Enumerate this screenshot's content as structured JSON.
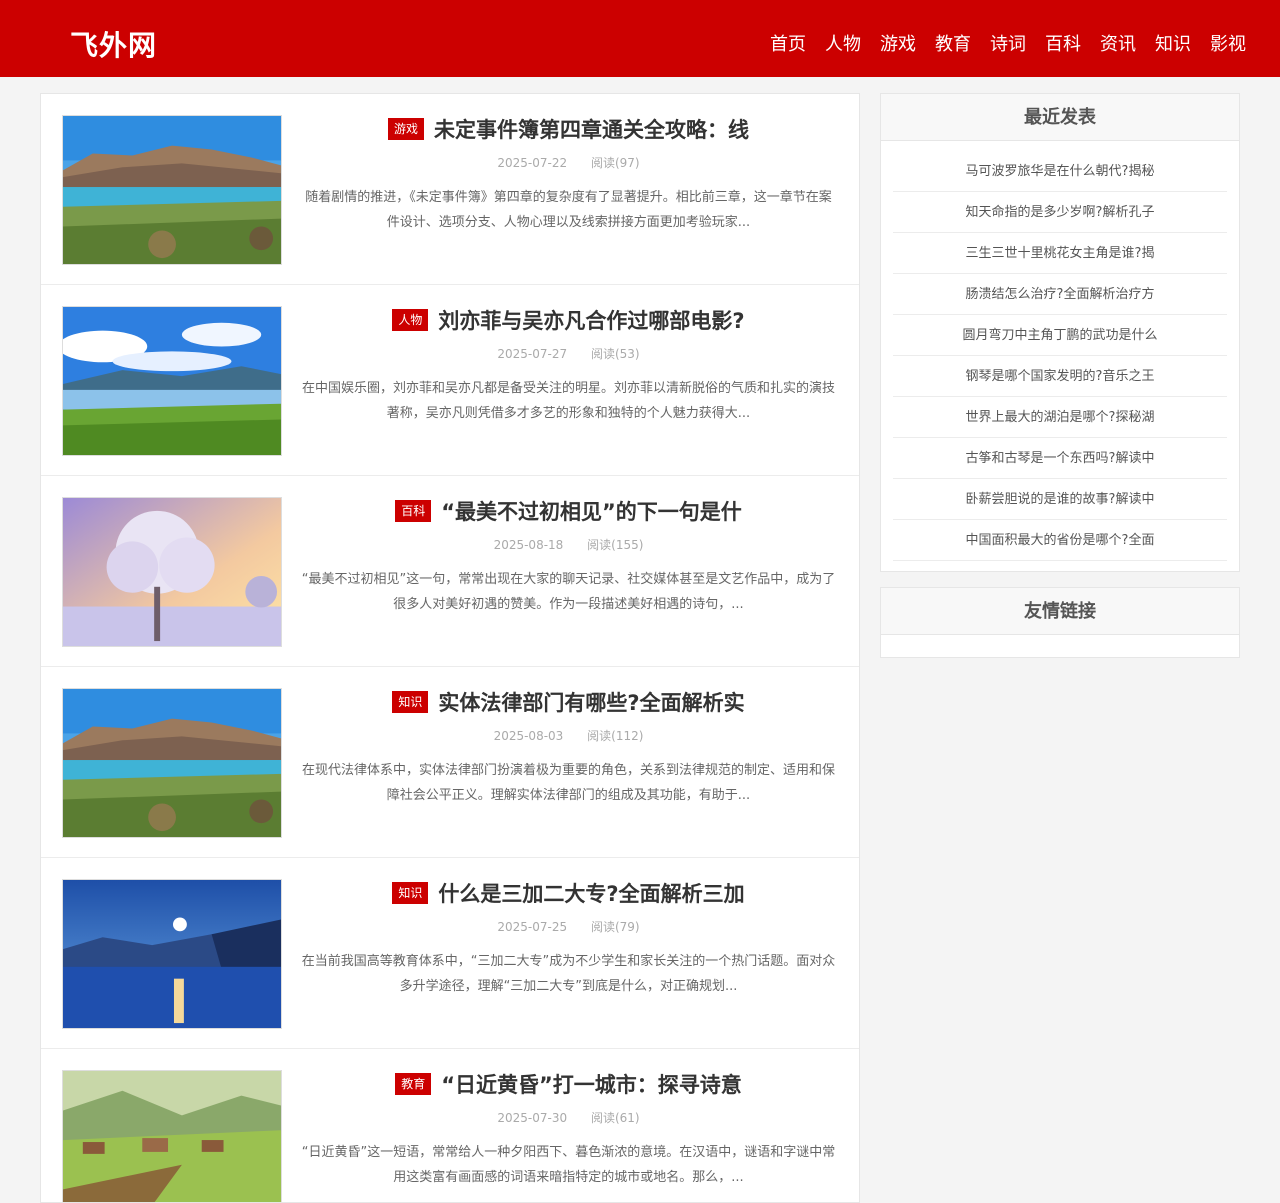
{
  "site": {
    "logo": "飞外网"
  },
  "nav": [
    "首页",
    "人物",
    "游戏",
    "教育",
    "诗词",
    "百科",
    "资讯",
    "知识",
    "影视"
  ],
  "posts": [
    {
      "category": "游戏",
      "title": "未定事件簿第四章通关全攻略：线",
      "date": "2025-07-22",
      "views": "阅读(97)",
      "excerpt": "随着剧情的推进，《未定事件簿》第四章的复杂度有了显著提升。相比前三章，这一章节在案件设计、选项分支、人物心理以及线索拼接方面更加考验玩家...",
      "image": "lake-cliff"
    },
    {
      "category": "人物",
      "title": "刘亦菲与吴亦凡合作过哪部电影?",
      "date": "2025-07-27",
      "views": "阅读(53)",
      "excerpt": "在中国娱乐圈，刘亦菲和吴亦凡都是备受关注的明星。刘亦菲以清新脱俗的气质和扎实的演技著称，吴亦凡则凭借多才多艺的形象和独特的个人魅力获得大...",
      "image": "blue-lake"
    },
    {
      "category": "百科",
      "title": "“最美不过初相见”的下一句是什",
      "date": "2025-08-18",
      "views": "阅读(155)",
      "excerpt": "“最美不过初相见”这一句，常常出现在大家的聊天记录、社交媒体甚至是文艺作品中，成为了很多人对美好初遇的赞美。作为一段描述美好相遇的诗句，...",
      "image": "frost-tree"
    },
    {
      "category": "知识",
      "title": "实体法律部门有哪些?全面解析实",
      "date": "2025-08-03",
      "views": "阅读(112)",
      "excerpt": "在现代法律体系中，实体法律部门扮演着极为重要的角色，关系到法律规范的制定、适用和保障社会公平正义。理解实体法律部门的组成及其功能，有助于...",
      "image": "lake-cliff"
    },
    {
      "category": "知识",
      "title": "什么是三加二大专?全面解析三加",
      "date": "2025-07-25",
      "views": "阅读(79)",
      "excerpt": "在当前我国高等教育体系中，“三加二大专”成为不少学生和家长关注的一个热门话题。面对众多升学途径，理解“三加二大专”到底是什么，对正确规划...",
      "image": "moon-lake"
    },
    {
      "category": "教育",
      "title": "“日近黄昏”打一城市：探寻诗意",
      "date": "2025-07-30",
      "views": "阅读(61)",
      "excerpt": "“日近黄昏”这一短语，常常给人一种夕阳西下、暮色渐浓的意境。在汉语中，谜语和字谜中常用这类富有画面感的词语来暗指特定的城市或地名。那么，...",
      "image": "meadow-village"
    }
  ],
  "sidebar": {
    "recent_title": "最近发表",
    "recent": [
      "马可波罗旅华是在什么朝代?揭秘",
      "知天命指的是多少岁啊?解析孔子",
      "三生三世十里桃花女主角是谁?揭",
      "肠溃结怎么治疗?全面解析治疗方",
      "圆月弯刀中主角丁鹏的武功是什么",
      "钢琴是哪个国家发明的?音乐之王",
      "世界上最大的湖泊是哪个?探秘湖",
      "古筝和古琴是一个东西吗?解读中",
      "卧薪尝胆说的是谁的故事?解读中",
      "中国面积最大的省份是哪个?全面"
    ],
    "links_title": "友情链接"
  },
  "colors": {
    "brand": "#cc0000"
  }
}
